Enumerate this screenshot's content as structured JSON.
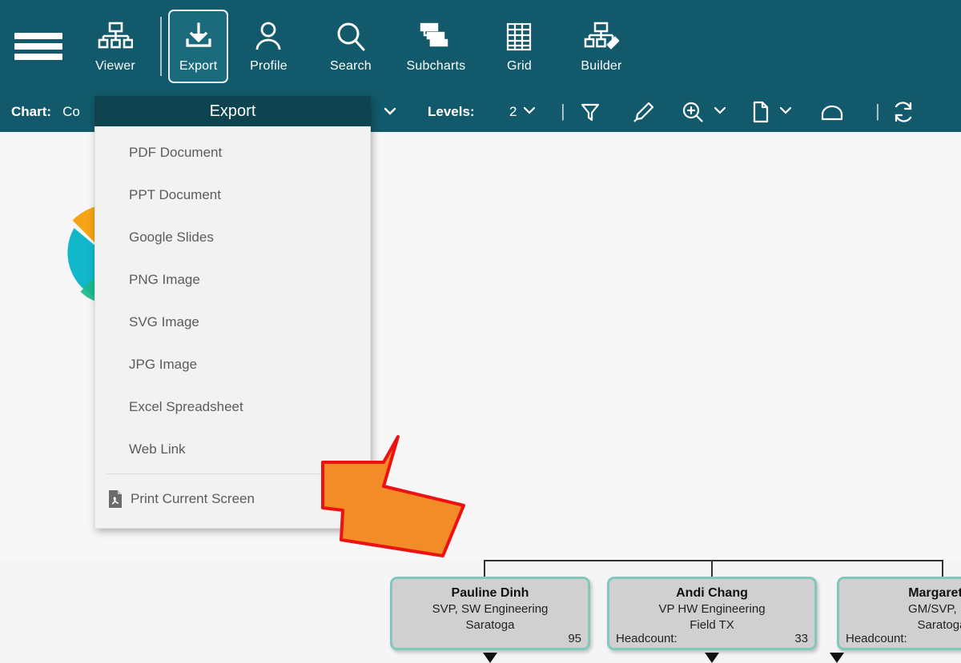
{
  "toolbar": {
    "menu_icon": "hamburger-icon",
    "items": [
      {
        "label": "Viewer",
        "icon": "org-chart-icon",
        "active": false
      },
      {
        "label": "Export",
        "icon": "download-icon",
        "active": true
      },
      {
        "label": "Profile",
        "icon": "person-icon",
        "active": false
      },
      {
        "label": "Search",
        "icon": "magnifier-icon",
        "active": false
      },
      {
        "label": "Subcharts",
        "icon": "subcharts-icon",
        "active": false
      },
      {
        "label": "Grid",
        "icon": "grid-icon",
        "active": false
      },
      {
        "label": "Builder",
        "icon": "builder-icon",
        "active": false
      }
    ]
  },
  "subbar": {
    "chart_label": "Chart:",
    "chart_value": "Co",
    "levels_label": "Levels:",
    "levels_value": "2",
    "icons": [
      "filter-icon",
      "highlighter-icon",
      "zoom-in-icon",
      "page-icon",
      "hide-icon",
      "refresh-icon"
    ]
  },
  "dropdown": {
    "title": "Export",
    "items": [
      {
        "label": "PDF Document"
      },
      {
        "label": "PPT Document"
      },
      {
        "label": "Google Slides"
      },
      {
        "label": "PNG Image"
      },
      {
        "label": "SVG Image"
      },
      {
        "label": "JPG Image"
      },
      {
        "label": "Excel Spreadsheet"
      },
      {
        "label": "Web Link"
      }
    ],
    "footer_item": {
      "label": "Print Current Screen",
      "icon": "pdf-file-icon"
    }
  },
  "chart": {
    "headcount_label": "Headcount:",
    "nodes": [
      {
        "name": "Pauline Dinh",
        "title": "SVP, SW Engineering",
        "location": "Saratoga",
        "headcount_label": "",
        "headcount": "95"
      },
      {
        "name": "Andi Chang",
        "title": "VP HW Engineering",
        "location": "Field TX",
        "headcount_label": "Headcount:",
        "headcount": "33"
      },
      {
        "name": "Margaret B",
        "title": "GM/SVP, De",
        "location": "Saratoga",
        "headcount_label": "Headcount:",
        "headcount": ""
      }
    ]
  },
  "colors": {
    "toolbar_bg": "#125a6b",
    "dropdown_header_bg": "#0d4450",
    "node_border": "#7fc9bc",
    "node_bg": "#d0d0d0",
    "arrow_fill": "#f28c28",
    "arrow_stroke": "#ee1111"
  }
}
